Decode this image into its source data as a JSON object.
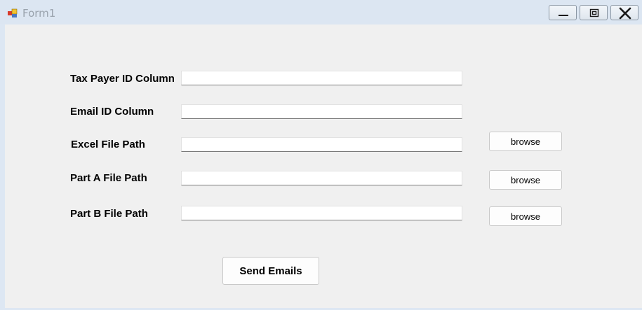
{
  "window": {
    "title": "Form1",
    "controls": [
      "minimize-icon",
      "maximize-icon",
      "close-icon"
    ]
  },
  "form": {
    "fields": [
      {
        "label": "Tax Payer ID Column",
        "value": ""
      },
      {
        "label": "Email ID Column",
        "value": ""
      },
      {
        "label": "Excel File Path",
        "value": ""
      },
      {
        "label": "Part A File Path",
        "value": ""
      },
      {
        "label": "Part B File Path",
        "value": ""
      }
    ],
    "browse_label": "browse",
    "send_label": "Send Emails"
  },
  "colors": {
    "titlebar": "#dce6f2",
    "client": "#f0f0f0",
    "textbox_border": "#7a7a7a"
  }
}
